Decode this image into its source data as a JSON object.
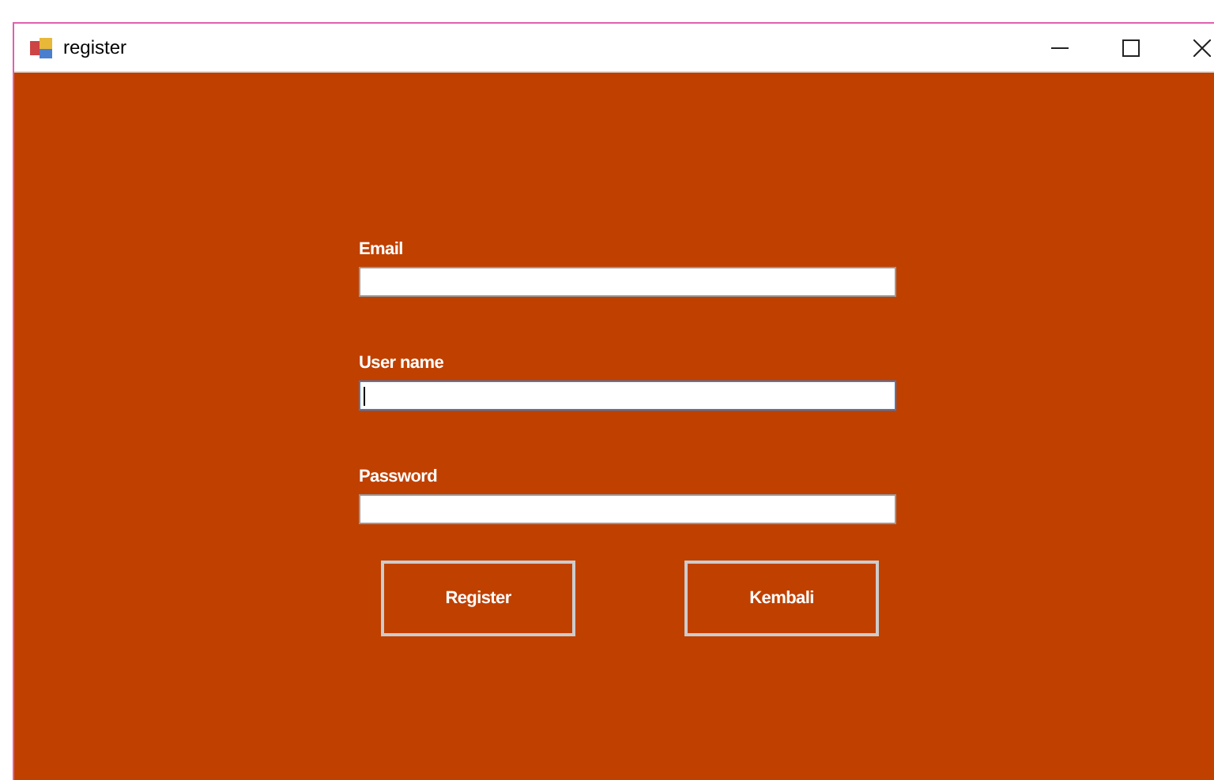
{
  "window": {
    "title": "register"
  },
  "fields": [
    {
      "label": "Email",
      "focused": false
    },
    {
      "label": "User name",
      "focused": true
    },
    {
      "label": "Password",
      "focused": false
    }
  ],
  "buttons": [
    "Register",
    "Kembali"
  ]
}
